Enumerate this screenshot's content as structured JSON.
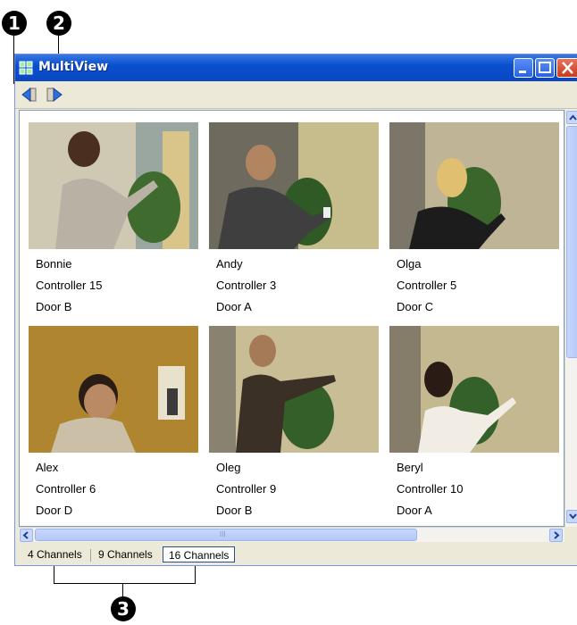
{
  "window": {
    "title": "MultiView"
  },
  "callouts": [
    "1",
    "2",
    "3"
  ],
  "cameras": [
    {
      "name": "Bonnie",
      "controller": "Controller 15",
      "door": "Door B"
    },
    {
      "name": "Andy",
      "controller": "Controller 3",
      "door": "Door A"
    },
    {
      "name": "Olga",
      "controller": "Controller 5",
      "door": "Door C"
    },
    {
      "name": "Alex",
      "controller": "Controller 6",
      "door": "Door D"
    },
    {
      "name": "Oleg",
      "controller": "Controller 9",
      "door": "Door B"
    },
    {
      "name": "Beryl",
      "controller": "Controller 10",
      "door": "Door A"
    }
  ],
  "tabs": [
    {
      "label": "4 Channels",
      "active": false
    },
    {
      "label": "9 Channels",
      "active": false
    },
    {
      "label": "16 Channels",
      "active": true
    }
  ],
  "scrollbar": {
    "grip": "III"
  },
  "colors": {
    "titlebar": "#0a4fcf",
    "accent": "#7a96df",
    "close": "#c83a1c"
  },
  "icons": [
    "app-grid-icon",
    "previous-icon",
    "next-icon",
    "minimize-icon",
    "maximize-icon",
    "close-icon"
  ]
}
